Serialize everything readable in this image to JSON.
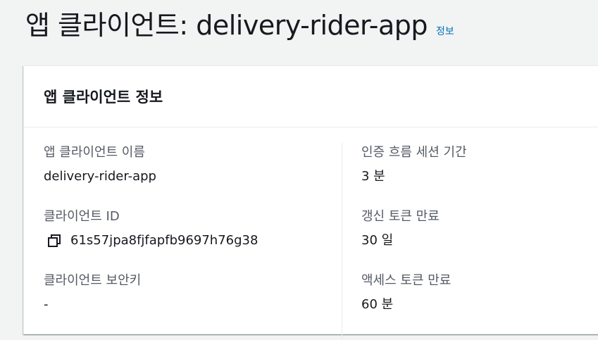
{
  "header": {
    "title": "앱 클라이언트: delivery-rider-app",
    "info_link": "정보"
  },
  "panel": {
    "title": "앱 클라이언트 정보",
    "left": [
      {
        "label": "앱 클라이언트 이름",
        "value": "delivery-rider-app"
      },
      {
        "label": "클라이언트 ID",
        "value": "61s57jpa8fjfapfb9697h76g38",
        "icon": "copy-icon"
      },
      {
        "label": "클라이언트 보안키",
        "value": "-"
      }
    ],
    "right": [
      {
        "label": "인증 흐름 세션 기간",
        "value": "3 분"
      },
      {
        "label": "갱신 토큰 만료",
        "value": "30 일"
      },
      {
        "label": "액세스 토큰 만료",
        "value": "60 분"
      }
    ]
  },
  "colors": {
    "background": "#f2f3f3",
    "link": "#0073bb",
    "label": "#545b64",
    "text": "#16191f"
  }
}
